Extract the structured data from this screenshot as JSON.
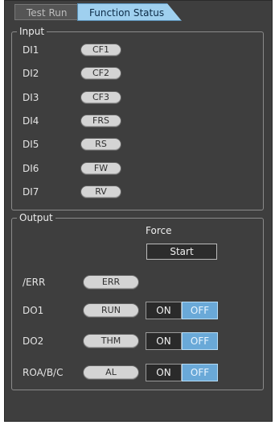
{
  "tabs": [
    {
      "label": "Test Run",
      "active": false
    },
    {
      "label": "Function Status",
      "active": true
    }
  ],
  "input": {
    "title": "Input",
    "rows": [
      {
        "label": "DI1",
        "value": "CF1"
      },
      {
        "label": "DI2",
        "value": "CF2"
      },
      {
        "label": "DI3",
        "value": "CF3"
      },
      {
        "label": "DI4",
        "value": "FRS"
      },
      {
        "label": "DI5",
        "value": "RS"
      },
      {
        "label": "DI6",
        "value": "FW"
      },
      {
        "label": "DI7",
        "value": "RV"
      }
    ]
  },
  "output": {
    "title": "Output",
    "force_label": "Force",
    "start_label": "Start",
    "rows": [
      {
        "label": "/ERR",
        "value": "ERR"
      },
      {
        "label": "DO1",
        "value": "RUN",
        "on": "ON",
        "off": "OFF",
        "state": "OFF"
      },
      {
        "label": "DO2",
        "value": "THM",
        "on": "ON",
        "off": "OFF",
        "state": "OFF"
      },
      {
        "label": "ROA/B/C",
        "value": "AL",
        "on": "ON",
        "off": "OFF",
        "state": "OFF"
      }
    ]
  },
  "colors": {
    "panel_bg": "#3e3e3e",
    "active_tab": "#9fd0ef",
    "pill": "#d4d4d4",
    "off_selected": "#6aa9d8"
  }
}
